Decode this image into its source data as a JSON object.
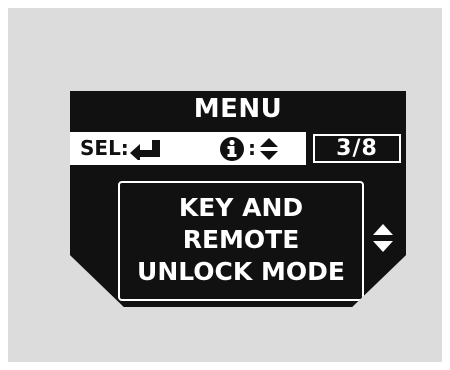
{
  "display": {
    "title": "MENU",
    "status_bar": {
      "select_label": "SEL:",
      "select_icon": "enter-return-icon",
      "info_icon": "info-icon",
      "info_separator": ":",
      "info_scroll_icon": "up-down-arrows-icon",
      "page_counter": "3/8"
    },
    "option": {
      "lines": [
        "KEY AND",
        "REMOTE",
        "UNLOCK MODE"
      ],
      "scroll_icon": "up-down-arrows-icon"
    }
  },
  "colors": {
    "background_panel": "#dcdcdc",
    "screen": "#111111",
    "text": "#ffffff",
    "status_bar": "#ffffff"
  }
}
